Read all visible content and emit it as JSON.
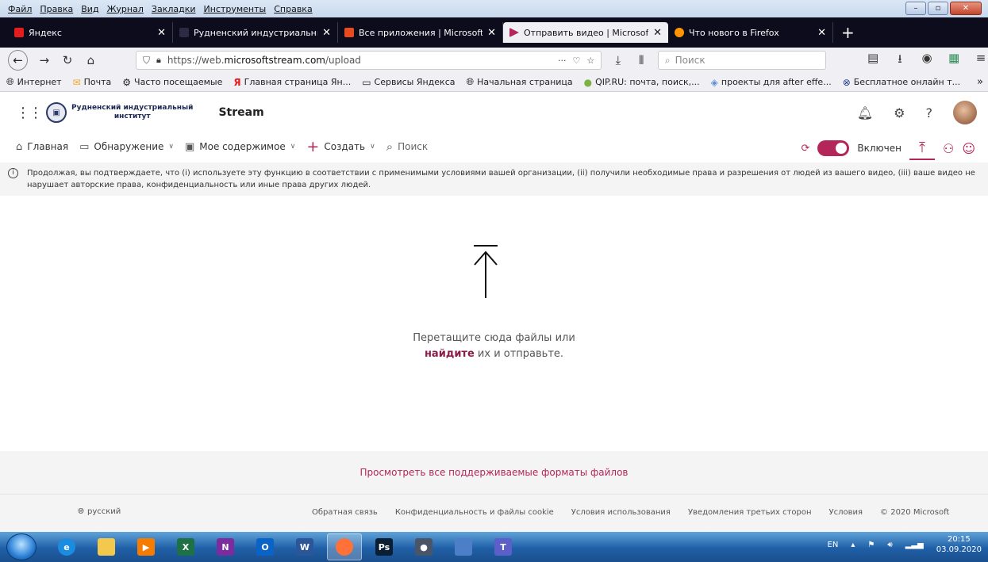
{
  "menu": [
    "Файл",
    "Правка",
    "Вид",
    "Журнал",
    "Закладки",
    "Инструменты",
    "Справка"
  ],
  "tabs": [
    {
      "title": "Яндекс",
      "favicon_color": "#e51c1c",
      "active": false
    },
    {
      "title": "Рудненский индустриальный",
      "favicon_color": "#2b2b46",
      "active": false
    },
    {
      "title": "Все приложения | Microsoft O",
      "favicon_color": "#e94a1f",
      "active": false
    },
    {
      "title": "Отправить видео | Microsoft S",
      "favicon_color": "#b4265a",
      "active": true
    },
    {
      "title": "Что нового в Firefox",
      "favicon_color": "#ff9500",
      "active": false
    }
  ],
  "nav": {
    "url_prefix": "https://web.",
    "url_host": "microsoftstream.com",
    "url_path": "/upload",
    "search_placeholder": "Поиск",
    "more_label": "···"
  },
  "bookmarks": [
    {
      "label": "Интернет",
      "icon": "globe-icon"
    },
    {
      "label": "Почта",
      "icon": "mail-icon"
    },
    {
      "label": "Часто посещаемые",
      "icon": "gear-icon"
    },
    {
      "label": "Главная страница Ян...",
      "icon": "yandex-icon"
    },
    {
      "label": "Сервисы Яндекса",
      "icon": "folder-icon"
    },
    {
      "label": "Начальная страница",
      "icon": "globe-icon"
    },
    {
      "label": "QIP.RU: почта, поиск,...",
      "icon": "qip-icon"
    },
    {
      "label": "проекты для after effe...",
      "icon": "drop-icon"
    },
    {
      "label": "Бесплатное онлайн т...",
      "icon": "x-circle-icon"
    }
  ],
  "app": {
    "org_line1": "Рудненский индустриальный",
    "org_line2": "институт",
    "product": "Stream"
  },
  "appnav": {
    "home": "Главная",
    "discover": "Обнаружение",
    "my_content": "Мое содержимое",
    "create": "Создать",
    "search": "Поиск",
    "toggle_label": "Включен"
  },
  "notice": "Продолжая, вы подтверждаете, что (i) используете эту функцию в соответствии с применимыми условиями вашей организации, (ii) получили необходимые права и разрешения от людей из вашего видео, (iii) ваше видео не нарушает авторские права, конфиденциальность или иные права других людей.",
  "drop": {
    "line1": "Перетащите сюда файлы или",
    "link": "найдите",
    "line2_rest": " их и отправьте."
  },
  "formats_link": "Просмотреть все поддерживаемые форматы файлов",
  "footer": {
    "language": "русский",
    "links": [
      "Обратная связь",
      "Конфиденциальность и файлы cookie",
      "Условия использования",
      "Уведомления третьих сторон",
      "Условия",
      "© 2020 Microsoft"
    ]
  },
  "taskbar": {
    "lang": "EN",
    "time": "20:15",
    "date": "03.09.2020",
    "apps": [
      {
        "name": "ie-icon",
        "label": "e",
        "color": "#1b8de0"
      },
      {
        "name": "explorer-icon",
        "label": "",
        "color": "#f2c94c"
      },
      {
        "name": "media-player-icon",
        "label": "▶",
        "color": "#f57c00"
      },
      {
        "name": "excel-icon",
        "label": "X",
        "color": "#1e7145"
      },
      {
        "name": "onenote-icon",
        "label": "N",
        "color": "#7b2c9e"
      },
      {
        "name": "outlook-icon",
        "label": "O",
        "color": "#0a64c8"
      },
      {
        "name": "word-icon",
        "label": "W",
        "color": "#2b579a"
      },
      {
        "name": "firefox-icon",
        "label": "",
        "color": "#ff7139"
      },
      {
        "name": "photoshop-icon",
        "label": "Ps",
        "color": "#0b1e33"
      },
      {
        "name": "camera-app-icon",
        "label": "●",
        "color": "#4a5668"
      },
      {
        "name": "network-app-icon",
        "label": "",
        "color": "#4d7fc8"
      },
      {
        "name": "teams-icon",
        "label": "T",
        "color": "#5b5fc7"
      }
    ]
  }
}
